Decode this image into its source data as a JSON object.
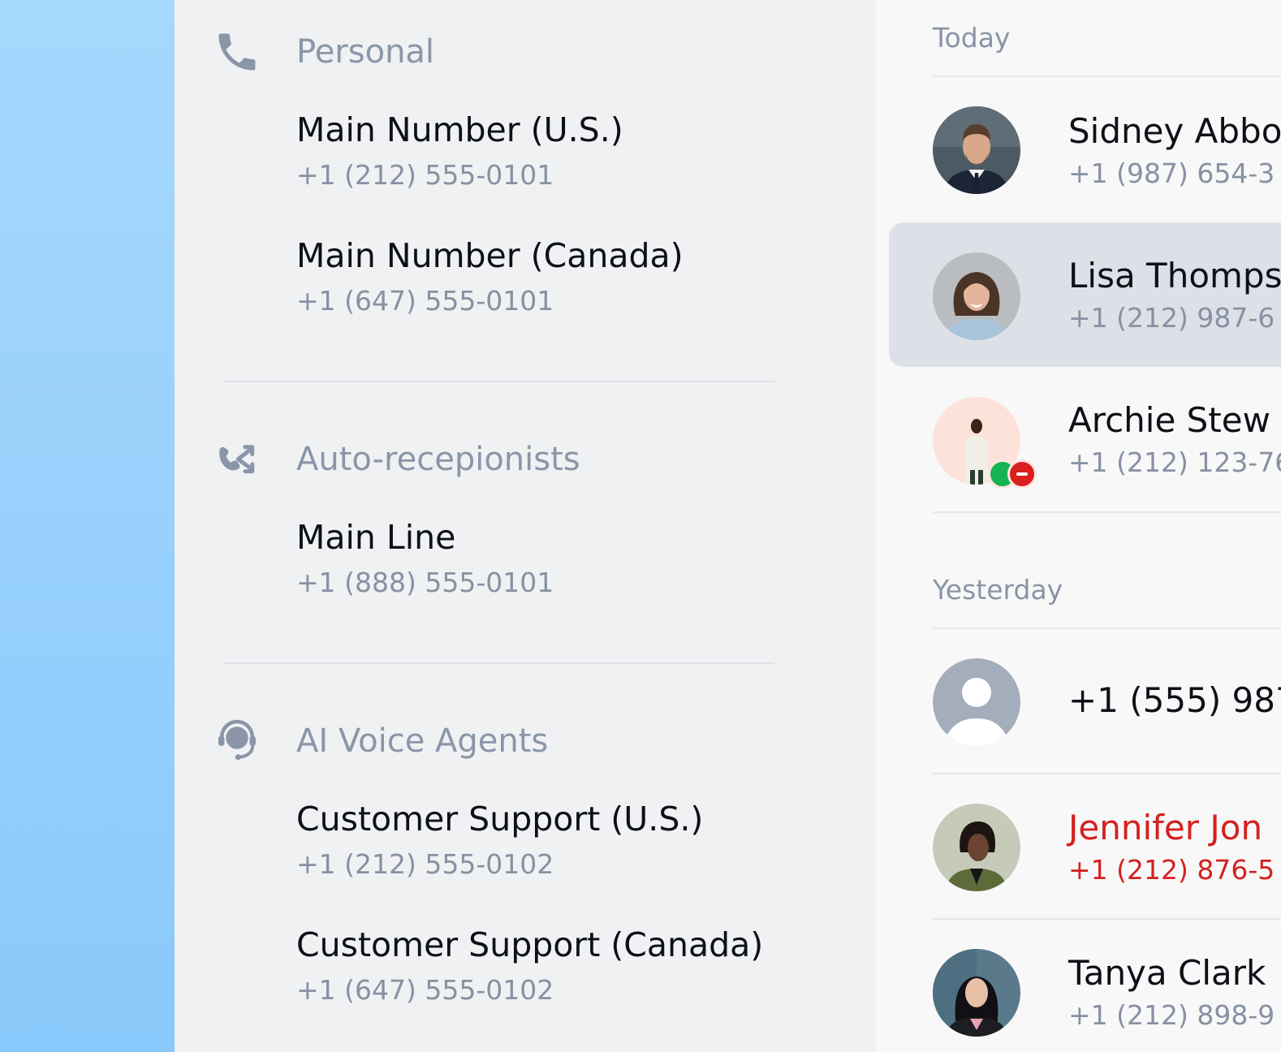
{
  "lines": {
    "groups": [
      {
        "icon": "phone-icon",
        "title": "Personal",
        "items": [
          {
            "name": "Main Number (U.S.)",
            "number": "+1 (212) 555-0101"
          },
          {
            "name": "Main Number (Canada)",
            "number": "+1 (647) 555-0101"
          }
        ]
      },
      {
        "icon": "call-routing-icon",
        "title": "Auto-recepionists",
        "items": [
          {
            "name": "Main Line",
            "number": "+1 (888) 555-0101"
          }
        ]
      },
      {
        "icon": "headset-agent-icon",
        "title": "AI Voice Agents",
        "items": [
          {
            "name": "Customer Support (U.S.)",
            "number": "+1 (212) 555-0102"
          },
          {
            "name": "Customer Support (Canada)",
            "number": "+1 (647) 555-0102"
          }
        ]
      }
    ]
  },
  "recents": {
    "sections": [
      {
        "label": "Today",
        "calls": [
          {
            "name": "Sidney Abbo",
            "number": "+1 (987) 654-3",
            "selected": false,
            "missed": false
          },
          {
            "name": "Lisa Thomps",
            "number": "+1 (212) 987-6",
            "selected": true,
            "missed": false
          },
          {
            "name": "Archie Stew",
            "number": "+1 (212) 123-76",
            "selected": false,
            "missed": false,
            "status": [
              "online",
              "do-not-disturb"
            ]
          }
        ]
      },
      {
        "label": "Yesterday",
        "calls": [
          {
            "name": "+1 (555) 987",
            "number": "",
            "selected": false,
            "missed": false,
            "unknown": true
          },
          {
            "name": "Jennifer Jon",
            "number": "+1 (212) 876-5",
            "selected": false,
            "missed": true
          },
          {
            "name": "Tanya Clark",
            "number": "+1 (212) 898-9",
            "selected": false,
            "missed": false
          }
        ]
      }
    ]
  },
  "colors": {
    "accent_bg": "#8ac9fb",
    "missed": "#d4211f",
    "online": "#16b353",
    "busy": "#d9201f"
  }
}
